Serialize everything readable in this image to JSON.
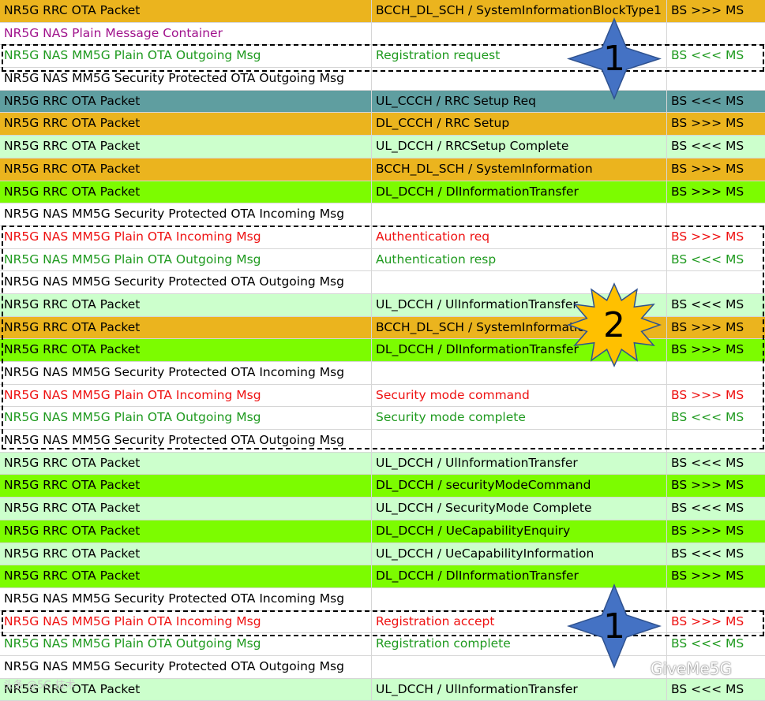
{
  "colors": {
    "orange": "#ebb41e",
    "teal": "#5f9ea0",
    "lightgreen": "#ccffcc",
    "brightgreen": "#7cfc00",
    "white": "#ffffff",
    "text_default": "#000000",
    "text_purple": "#a0128c",
    "text_green": "#1f9a1f",
    "text_red": "#ee1111"
  },
  "rows": [
    {
      "c1": "NR5G RRC OTA Packet",
      "c2": "BCCH_DL_SCH / SystemInformationBlockType1",
      "c3": "BS >>> MS",
      "bg": "orange",
      "fg": "default"
    },
    {
      "c1": "NR5G NAS Plain Message Container",
      "c2": "",
      "c3": "",
      "bg": "white",
      "fg": "purple"
    },
    {
      "c1": "NR5G NAS MM5G Plain OTA Outgoing Msg",
      "c2": "Registration request",
      "c3": "BS <<< MS",
      "bg": "white",
      "fg": "green"
    },
    {
      "c1": "NR5G NAS MM5G Security Protected OTA Outgoing Msg",
      "c2": "",
      "c3": "",
      "bg": "white",
      "fg": "default"
    },
    {
      "c1": "NR5G RRC OTA Packet",
      "c2": "UL_CCCH / RRC Setup Req",
      "c3": "BS <<< MS",
      "bg": "teal",
      "fg": "default"
    },
    {
      "c1": "NR5G RRC OTA Packet",
      "c2": "DL_CCCH / RRC Setup",
      "c3": "BS >>> MS",
      "bg": "orange",
      "fg": "default"
    },
    {
      "c1": "NR5G RRC OTA Packet",
      "c2": "UL_DCCH / RRCSetup Complete",
      "c3": "BS <<< MS",
      "bg": "lightgreen",
      "fg": "default"
    },
    {
      "c1": "NR5G RRC OTA Packet",
      "c2": "BCCH_DL_SCH / SystemInformation",
      "c3": "BS >>> MS",
      "bg": "orange",
      "fg": "default"
    },
    {
      "c1": "NR5G RRC OTA Packet",
      "c2": "DL_DCCH / DlInformationTransfer",
      "c3": "BS >>> MS",
      "bg": "brightgreen",
      "fg": "default"
    },
    {
      "c1": "NR5G NAS MM5G Security Protected OTA Incoming Msg",
      "c2": "",
      "c3": "",
      "bg": "white",
      "fg": "default"
    },
    {
      "c1": "NR5G NAS MM5G Plain OTA Incoming Msg",
      "c2": "Authentication req",
      "c3": "BS >>> MS",
      "bg": "white",
      "fg": "red"
    },
    {
      "c1": "NR5G NAS MM5G Plain OTA Outgoing Msg",
      "c2": "Authentication resp",
      "c3": "BS <<< MS",
      "bg": "white",
      "fg": "green"
    },
    {
      "c1": "NR5G NAS MM5G Security Protected OTA Outgoing Msg",
      "c2": "",
      "c3": "",
      "bg": "white",
      "fg": "default"
    },
    {
      "c1": "NR5G RRC OTA Packet",
      "c2": "UL_DCCH / UlInformationTransfer",
      "c3": "BS <<< MS",
      "bg": "lightgreen",
      "fg": "default"
    },
    {
      "c1": "NR5G RRC OTA Packet",
      "c2": "BCCH_DL_SCH / SystemInformation",
      "c3": "BS >>> MS",
      "bg": "orange",
      "fg": "default"
    },
    {
      "c1": "NR5G RRC OTA Packet",
      "c2": "DL_DCCH / DlInformationTransfer",
      "c3": "BS >>> MS",
      "bg": "brightgreen",
      "fg": "default"
    },
    {
      "c1": "NR5G NAS MM5G Security Protected OTA Incoming Msg",
      "c2": "",
      "c3": "",
      "bg": "white",
      "fg": "default"
    },
    {
      "c1": "NR5G NAS MM5G Plain OTA Incoming Msg",
      "c2": "Security mode command",
      "c3": "BS >>> MS",
      "bg": "white",
      "fg": "red"
    },
    {
      "c1": "NR5G NAS MM5G Plain OTA Outgoing Msg",
      "c2": "Security mode complete",
      "c3": "BS <<< MS",
      "bg": "white",
      "fg": "green"
    },
    {
      "c1": "NR5G NAS MM5G Security Protected OTA Outgoing Msg",
      "c2": "",
      "c3": "",
      "bg": "white",
      "fg": "default"
    },
    {
      "c1": "NR5G RRC OTA Packet",
      "c2": "UL_DCCH / UlInformationTransfer",
      "c3": "BS <<< MS",
      "bg": "lightgreen",
      "fg": "default"
    },
    {
      "c1": "NR5G RRC OTA Packet",
      "c2": "DL_DCCH / securityModeCommand",
      "c3": "BS >>> MS",
      "bg": "brightgreen",
      "fg": "default"
    },
    {
      "c1": "NR5G RRC OTA Packet",
      "c2": "UL_DCCH / SecurityMode Complete",
      "c3": "BS <<< MS",
      "bg": "lightgreen",
      "fg": "default"
    },
    {
      "c1": "NR5G RRC OTA Packet",
      "c2": "DL_DCCH / UeCapabilityEnquiry",
      "c3": "BS >>> MS",
      "bg": "brightgreen",
      "fg": "default"
    },
    {
      "c1": "NR5G RRC OTA Packet",
      "c2": "UL_DCCH / UeCapabilityInformation",
      "c3": "BS <<< MS",
      "bg": "lightgreen",
      "fg": "default"
    },
    {
      "c1": "NR5G RRC OTA Packet",
      "c2": "DL_DCCH / DlInformationTransfer",
      "c3": "BS >>> MS",
      "bg": "brightgreen",
      "fg": "default"
    },
    {
      "c1": "NR5G NAS MM5G Security Protected OTA Incoming Msg",
      "c2": "",
      "c3": "",
      "bg": "white",
      "fg": "default"
    },
    {
      "c1": "NR5G NAS MM5G Plain OTA Incoming Msg",
      "c2": "Registration accept",
      "c3": "BS >>> MS",
      "bg": "white",
      "fg": "red"
    },
    {
      "c1": "NR5G NAS MM5G Plain OTA Outgoing Msg",
      "c2": "Registration complete",
      "c3": "BS <<< MS",
      "bg": "white",
      "fg": "green"
    },
    {
      "c1": "NR5G NAS MM5G Security Protected OTA Outgoing Msg",
      "c2": "",
      "c3": "",
      "bg": "white",
      "fg": "default"
    },
    {
      "c1": "NR5G RRC OTA Packet",
      "c2": "UL_DCCH / UlInformationTransfer",
      "c3": "BS <<< MS",
      "bg": "lightgreen",
      "fg": "default"
    }
  ],
  "annotations": {
    "star1_top": {
      "label": "1",
      "color": "#4472c4"
    },
    "star2": {
      "label": "2",
      "color": "#ffc000"
    },
    "star1_bottom": {
      "label": "1",
      "color": "#4472c4"
    }
  },
  "watermark": {
    "left_text": "头条 @5G 技术",
    "right_text": "GiveMe5G",
    "icon": "wechat-icon"
  }
}
